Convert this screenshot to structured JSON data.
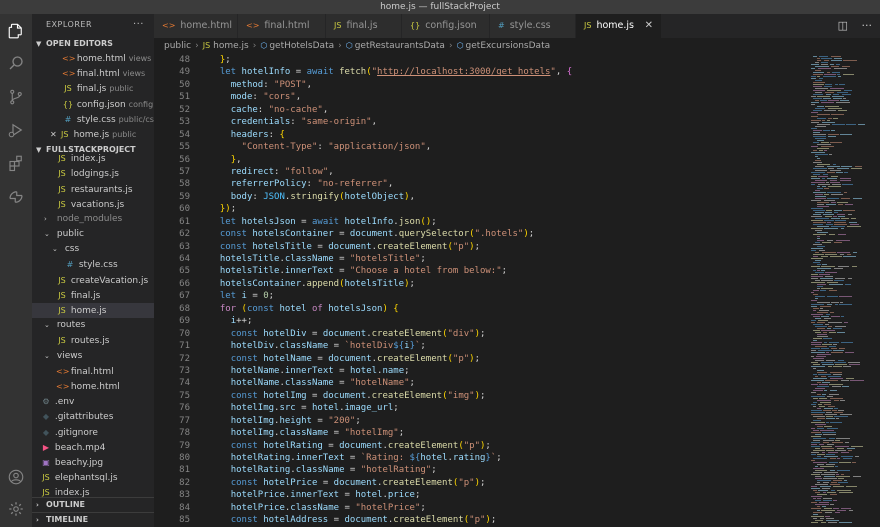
{
  "window": {
    "title": "home.js — fullStackProject"
  },
  "activity_bar": {
    "icons": [
      "files-icon",
      "search-icon",
      "source-control-icon",
      "run-debug-icon",
      "extensions-icon",
      "remote-icon",
      "account-icon",
      "settings-gear-icon"
    ]
  },
  "sidebar": {
    "title": "EXPLORER",
    "more": "···",
    "open_editors": {
      "label": "OPEN EDITORS",
      "items": [
        {
          "name": "home.html",
          "sub": "views",
          "icon": "<>",
          "icon_color": "#e37933"
        },
        {
          "name": "final.html",
          "sub": "views",
          "icon": "<>",
          "icon_color": "#e37933"
        },
        {
          "name": "final.js",
          "sub": "public",
          "icon": "JS",
          "icon_color": "#cbcb41"
        },
        {
          "name": "config.json",
          "sub": "config",
          "icon": "{}",
          "icon_color": "#cbcb41"
        },
        {
          "name": "style.css",
          "sub": "public/css",
          "icon": "#",
          "icon_color": "#519aba"
        },
        {
          "name": "home.js",
          "sub": "public",
          "icon": "JS",
          "icon_color": "#cbcb41",
          "active": true
        }
      ]
    },
    "project": {
      "label": "FULLSTACKPROJECT",
      "items": [
        {
          "name": "index.js",
          "icon": "JS",
          "icon_color": "#cbcb41",
          "indent": 1
        },
        {
          "name": "lodgings.js",
          "icon": "JS",
          "icon_color": "#cbcb41",
          "indent": 1
        },
        {
          "name": "restaurants.js",
          "icon": "JS",
          "icon_color": "#cbcb41",
          "indent": 1
        },
        {
          "name": "vacations.js",
          "icon": "JS",
          "icon_color": "#cbcb41",
          "indent": 1
        },
        {
          "name": "node_modules",
          "folder": "closed",
          "indent": 0,
          "dim": true
        },
        {
          "name": "public",
          "folder": "open",
          "indent": 0
        },
        {
          "name": "css",
          "folder": "open",
          "indent": 1
        },
        {
          "name": "style.css",
          "icon": "#",
          "icon_color": "#519aba",
          "indent": 2
        },
        {
          "name": "createVacation.js",
          "icon": "JS",
          "icon_color": "#cbcb41",
          "indent": 1
        },
        {
          "name": "final.js",
          "icon": "JS",
          "icon_color": "#cbcb41",
          "indent": 1
        },
        {
          "name": "home.js",
          "icon": "JS",
          "icon_color": "#cbcb41",
          "indent": 1,
          "selected": true
        },
        {
          "name": "routes",
          "folder": "open",
          "indent": 0
        },
        {
          "name": "routes.js",
          "icon": "JS",
          "icon_color": "#cbcb41",
          "indent": 1
        },
        {
          "name": "views",
          "folder": "open",
          "indent": 0
        },
        {
          "name": "final.html",
          "icon": "<>",
          "icon_color": "#e37933",
          "indent": 1
        },
        {
          "name": "home.html",
          "icon": "<>",
          "icon_color": "#e37933",
          "indent": 1
        },
        {
          "name": ".env",
          "icon": "⚙",
          "icon_color": "#6d8086",
          "indent": -1
        },
        {
          "name": ".gitattributes",
          "icon": "◆",
          "icon_color": "#41535b",
          "indent": -1
        },
        {
          "name": ".gitignore",
          "icon": "◆",
          "icon_color": "#41535b",
          "indent": -1
        },
        {
          "name": "beach.mp4",
          "icon": "▶",
          "icon_color": "#f55385",
          "indent": -1
        },
        {
          "name": "beachy.jpg",
          "icon": "▣",
          "icon_color": "#a074c4",
          "indent": -1
        },
        {
          "name": "elephantsql.js",
          "icon": "JS",
          "icon_color": "#cbcb41",
          "indent": -1
        },
        {
          "name": "index.js",
          "icon": "JS",
          "icon_color": "#cbcb41",
          "indent": -1
        }
      ]
    },
    "outline_label": "OUTLINE",
    "timeline_label": "TIMELINE"
  },
  "tabs": [
    {
      "label": "home.html",
      "icon": "<>",
      "icon_color": "#e37933"
    },
    {
      "label": "final.html",
      "icon": "<>",
      "icon_color": "#e37933"
    },
    {
      "label": "final.js",
      "icon": "JS",
      "icon_color": "#cbcb41"
    },
    {
      "label": "config.json",
      "icon": "{}",
      "icon_color": "#cbcb41"
    },
    {
      "label": "style.css",
      "icon": "#",
      "icon_color": "#519aba"
    },
    {
      "label": "home.js",
      "icon": "JS",
      "icon_color": "#cbcb41",
      "active": true
    }
  ],
  "breadcrumb": [
    "public",
    "home.js",
    "getHotelsData",
    "getRestaurantsData",
    "getExcursionsData"
  ],
  "editor": {
    "language": "javascript",
    "first_line": 48,
    "lines": [
      "  };",
      "  let hotelInfo = await fetch(\"http://localhost:3000/get_hotels\", {",
      "    method: \"POST\",",
      "    mode: \"cors\",",
      "    cache: \"no-cache\",",
      "    credentials: \"same-origin\",",
      "    headers: {",
      "      \"Content-Type\": \"application/json\",",
      "    },",
      "    redirect: \"follow\",",
      "    referrerPolicy: \"no-referrer\",",
      "    body: JSON.stringify(hotelObject),",
      "  });",
      "  let hotelsJson = await hotelInfo.json();",
      "  const hotelsContainer = document.querySelector(\".hotels\");",
      "  const hotelsTitle = document.createElement(\"p\");",
      "  hotelsTitle.className = \"hotelsTitle\";",
      "  hotelsTitle.innerText = \"Choose a hotel from below:\";",
      "  hotelsContainer.append(hotelsTitle);",
      "  let i = 0;",
      "  for (const hotel of hotelsJson) {",
      "    i++;",
      "    const hotelDiv = document.createElement(\"div\");",
      "    hotelDiv.className = `hotelDiv${i}`;",
      "    const hotelName = document.createElement(\"p\");",
      "    hotelName.innerText = hotel.name;",
      "    hotelName.className = \"hotelName\";",
      "    const hotelImg = document.createElement(\"img\");",
      "    hotelImg.src = hotel.image_url;",
      "    hotelImg.height = \"200\";",
      "    hotelImg.className = \"hotelImg\";",
      "    const hotelRating = document.createElement(\"p\");",
      "    hotelRating.innerText = `Rating: ${hotel.rating}`;",
      "    hotelRating.className = \"hotelRating\";",
      "    const hotelPrice = document.createElement(\"p\");",
      "    hotelPrice.innerText = hotel.price;",
      "    hotelPrice.className = \"hotelPrice\";",
      "    const hotelAddress = document.createElement(\"p\");"
    ]
  },
  "colors": {
    "activity_bar": "#333333",
    "sidebar": "#252526",
    "editor": "#1e1e1e",
    "tab_inactive": "#2d2d2d",
    "selection": "#37373d",
    "title_bar": "#3c3c3c"
  }
}
